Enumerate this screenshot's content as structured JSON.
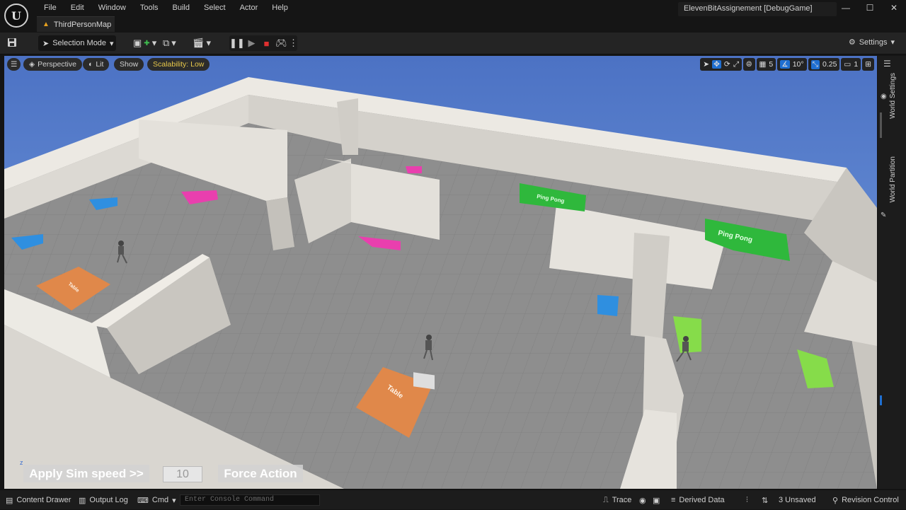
{
  "menubar": {
    "logo": "U",
    "menus": [
      "File",
      "Edit",
      "Window",
      "Tools",
      "Build",
      "Select",
      "Actor",
      "Help"
    ],
    "project_title": "ElevenBitAssignement [DebugGame]",
    "doc_tab": "ThirdPersonMap"
  },
  "toolbar": {
    "selection_mode": "Selection Mode",
    "settings": "Settings"
  },
  "viewport": {
    "perspective": "Perspective",
    "lit": "Lit",
    "show": "Show",
    "scalability": "Scalability: Low",
    "grid_snap": "5",
    "rotation_snap": "10°",
    "scale_snap": "0.25",
    "camera_speed": "1",
    "scene": {
      "labels": {
        "ping_pong_1": "Ping Pong",
        "ping_pong_2": "Ping Pong",
        "table_1": "Table",
        "table_2": "Table"
      }
    },
    "overlay": {
      "apply_sim_speed": "Apply Sim speed >>",
      "sim_speed_value": "10",
      "force_action": "Force Action"
    }
  },
  "side_panel": {
    "world_settings": "World Settings",
    "world_partition": "World Partition"
  },
  "statusbar": {
    "content_drawer": "Content Drawer",
    "output_log": "Output Log",
    "cmd": "Cmd",
    "console_placeholder": "Enter Console Command",
    "trace": "Trace",
    "derived_data": "Derived Data",
    "unsaved": "3 Unsaved",
    "revision_control": "Revision Control"
  },
  "colors": {
    "sky": "#5a80cc",
    "floor": "#8c8c8c",
    "wall": "#e2dfd9",
    "orange_table": "#e0884a",
    "green": "#2fb83c",
    "light_green": "#86dc4a",
    "pink": "#e93fae",
    "blue": "#2f8fe0"
  }
}
